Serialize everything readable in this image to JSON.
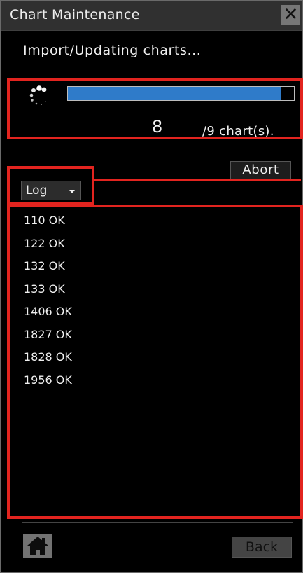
{
  "window": {
    "title": "Chart Maintenance",
    "close_icon": "close-icon"
  },
  "status_text": "Import/Updating charts...",
  "progress": {
    "spinner_icon": "loading-spinner-icon",
    "fraction": 0.94,
    "current": "8",
    "total_label": "/9 chart(s)."
  },
  "abort_label": "Abort",
  "log_selector": {
    "selected": "Log",
    "icon": "chevron-down-icon"
  },
  "log_entries": [
    "110 OK",
    "122 OK",
    "132 OK",
    "133 OK",
    "1406 OK",
    "1827 OK",
    "1828 OK",
    "1956 OK"
  ],
  "footer": {
    "home_icon": "home-icon",
    "back_label": "Back"
  },
  "colors": {
    "highlight": "#e2241f",
    "progress_fill": "#2f7bc9",
    "background": "#000000",
    "titlebar": "#303030"
  }
}
